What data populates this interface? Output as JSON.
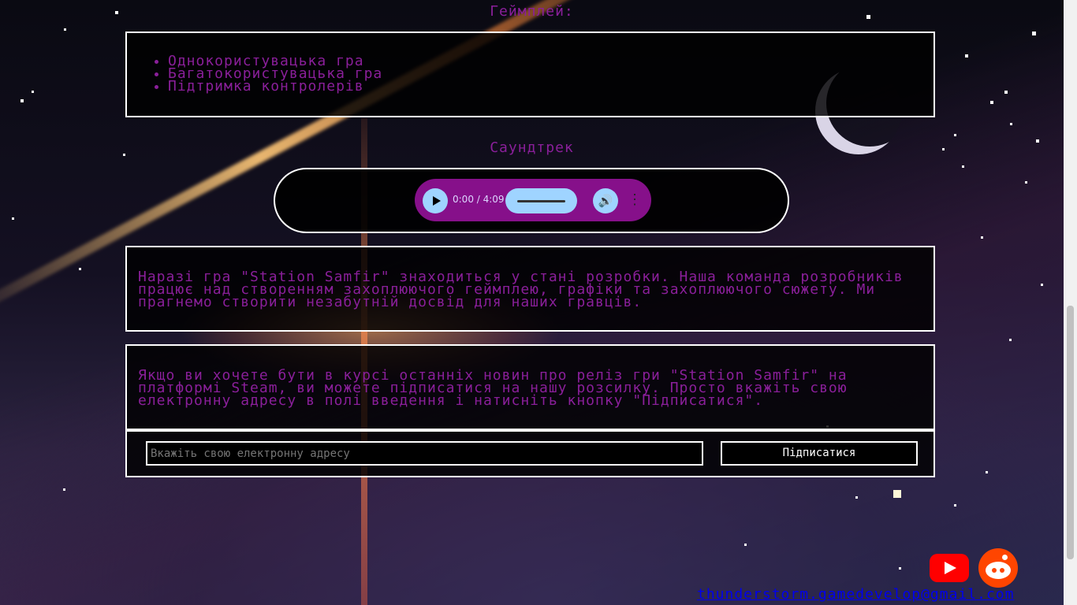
{
  "gameplay": {
    "heading": "Геймплей:",
    "items": [
      "Однокористувацька гра",
      "Багатокористувацька гра",
      "Підтримка контролерів"
    ]
  },
  "soundtrack": {
    "heading": "Саундтрек",
    "time": "0:00 / 4:09",
    "progress": 0
  },
  "status_text": "Наразі гра \"Station Samfir\" знаходиться у стані розробки. Наша команда розробників працює над створенням захоплюючого геймплею, графіки та захоплюючого сюжету. Ми прагнемо створити незабутній досвід для наших гравців.",
  "newsletter": {
    "text": "Якщо ви хочете бути в курсі останніх новин про реліз гри \"Station Samfir\" на платформі Steam, ви можете підписатися на нашу розсилку. Просто вкажіть свою електронну адресу в полі введення і натисніть кнопку \"Підписатися\".",
    "email_placeholder": "Вкажіть свою електронну адресу",
    "subscribe_label": "Підписатися"
  },
  "footer": {
    "contact_email": "thunderstorm.gamedevelop@gmail.com",
    "social": [
      "youtube-icon",
      "reddit-icon"
    ]
  },
  "colors": {
    "text_accent": "#8a1f9a",
    "player_bg": "#86108a",
    "player_controls": "#9fd4ff",
    "youtube": "#ff0000",
    "reddit": "#ff4500"
  }
}
